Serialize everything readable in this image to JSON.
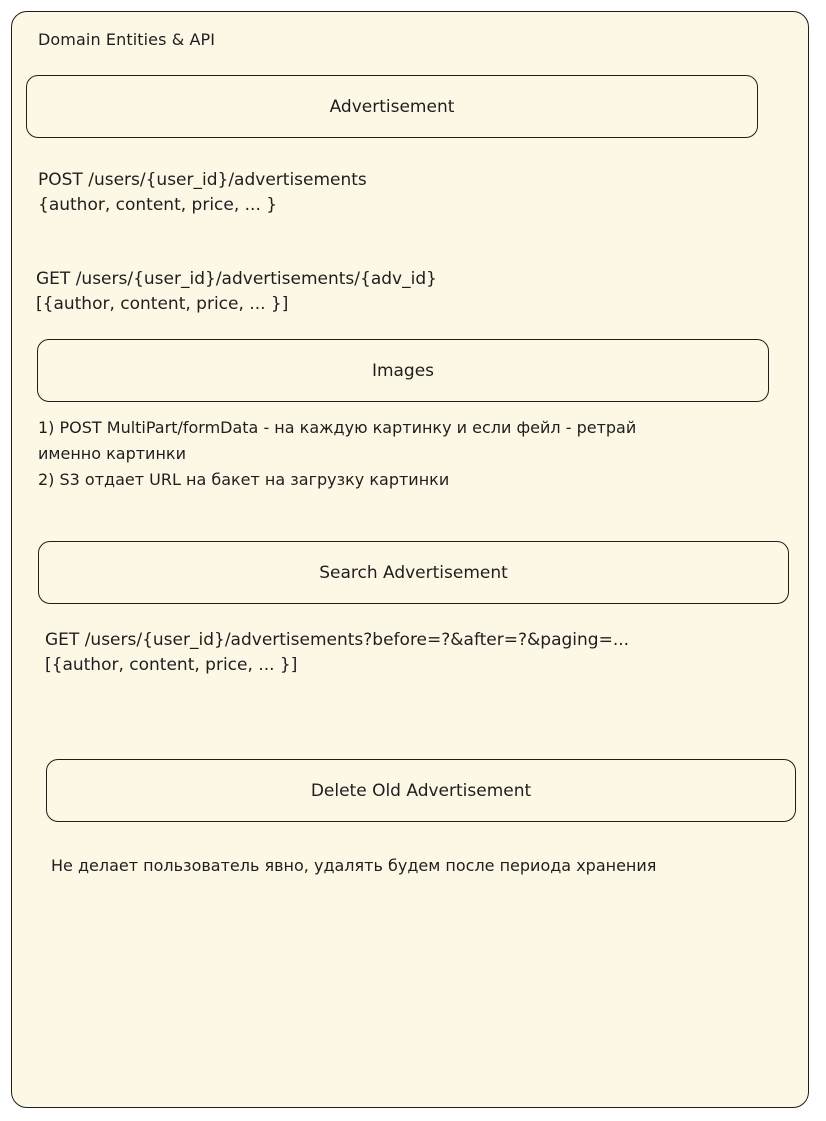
{
  "frame": {
    "title": "Domain Entities & API"
  },
  "sections": {
    "advertisement": {
      "label": "Advertisement",
      "post_line1": "POST /users/{user_id}/advertisements",
      "post_line2": "{author, content, price, ... }",
      "get_line1": "GET /users/{user_id}/advertisements/{adv_id}",
      "get_line2": "[{author, content, price, ... }]"
    },
    "images": {
      "label": "Images",
      "line1": "1) POST MultiPart/formData - на каждую картинку и если фейл - ретрай",
      "line2": "именно картинки",
      "line3": "2) S3 отдает URL на бакет на загрузку картинки"
    },
    "search": {
      "label": "Search Advertisement",
      "line1": "GET /users/{user_id}/advertisements?before=?&after=?&paging=...",
      "line2": "[{author, content, price, ... }]"
    },
    "delete": {
      "label": "Delete Old Advertisement",
      "note": "Не делает пользователь явно, удалять будем после периода хранения"
    }
  },
  "colors": {
    "frame_fill": "#fdf8e6",
    "stroke": "#1e1e1e"
  }
}
